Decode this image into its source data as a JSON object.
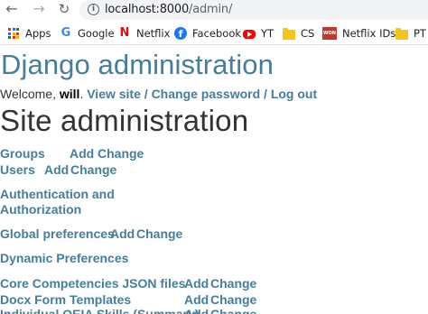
{
  "browser": {
    "url_host": "localhost:8000",
    "url_path": "/admin/",
    "icons": {
      "back": "back-arrow-icon",
      "forward": "forward-arrow-icon",
      "reload": "reload-icon",
      "info": "info-icon"
    },
    "bookmarks": [
      {
        "label": "Apps",
        "icon": "apps-grid-icon"
      },
      {
        "label": "Google",
        "icon": "google-icon"
      },
      {
        "label": "Netflix",
        "icon": "netflix-icon"
      },
      {
        "label": "Facebook",
        "icon": "facebook-icon"
      },
      {
        "label": "YT",
        "icon": "youtube-icon"
      },
      {
        "label": "CS",
        "icon": "folder-icon"
      },
      {
        "label": "Netflix IDs",
        "icon": "won-icon"
      },
      {
        "label": "PT",
        "icon": "folder-icon"
      }
    ]
  },
  "header": {
    "site_name": "Django administration",
    "welcome": "Welcome, ",
    "username": "will",
    "period": ". ",
    "view_site": "View site",
    "sep1": " / ",
    "change_password": "Change password",
    "sep2": " / ",
    "logout": "Log out"
  },
  "content": {
    "title": "Site administration",
    "add_label": "Add",
    "change_label": "Change",
    "apps": [
      {
        "caption": "Groups",
        "models": []
      },
      {
        "caption": "Users",
        "models": []
      },
      {
        "caption": "Authentication and Authorization",
        "caption_line1": "Authentication and",
        "caption_line2": "Authorization"
      },
      {
        "caption": "Global preferences"
      },
      {
        "caption": "Dynamic Preferences"
      },
      {
        "caption": "Core Competencies JSON files"
      },
      {
        "caption": "Docx Form Templates"
      },
      {
        "caption": "Individual OEIA Skills (Summary)"
      }
    ]
  },
  "colors": {
    "link": "#447e9b",
    "title": "#333333",
    "omnibox": "#f1f3f4"
  }
}
